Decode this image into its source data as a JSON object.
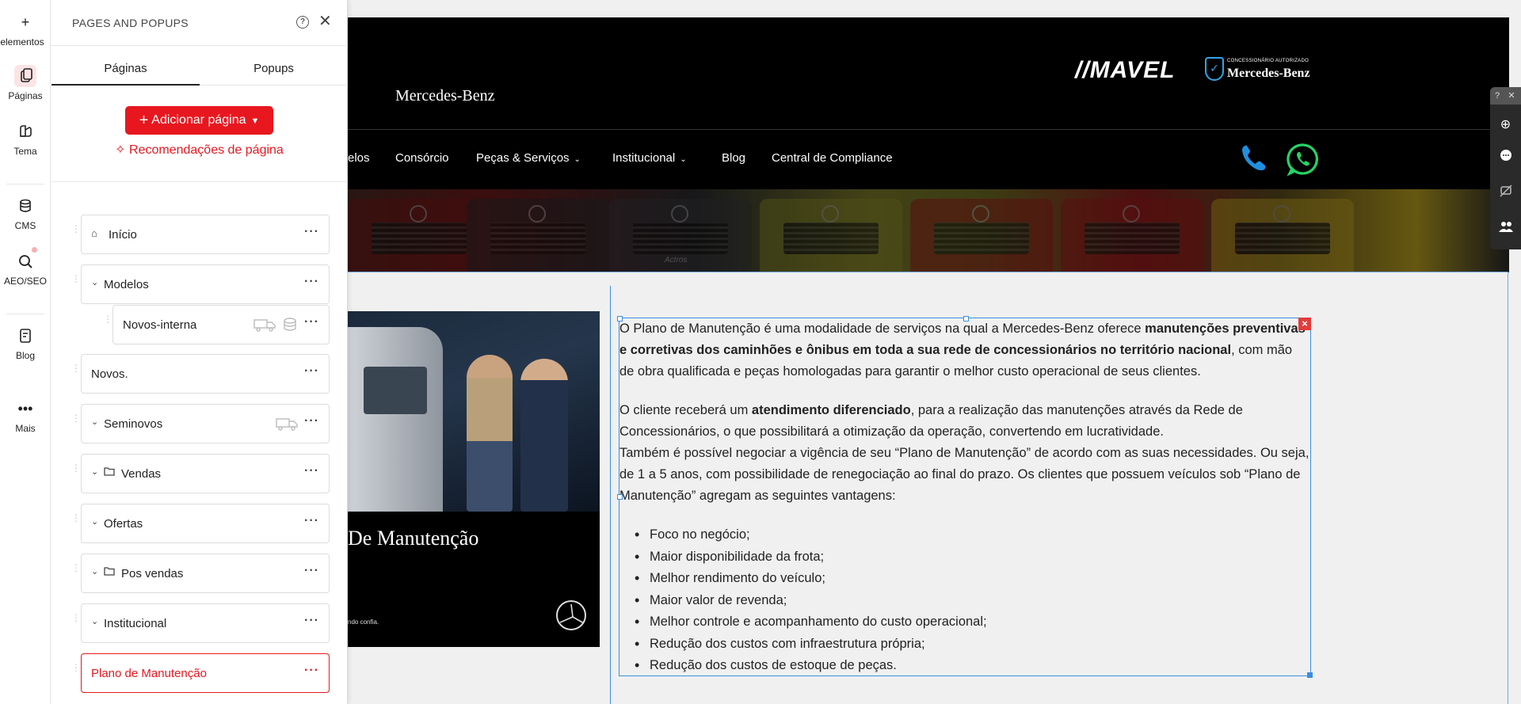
{
  "rail": {
    "items": [
      {
        "label": "elementos",
        "icon": "plus-icon"
      },
      {
        "label": "Páginas",
        "icon": "pages-icon",
        "active": true
      },
      {
        "label": "Tema",
        "icon": "palette-icon"
      },
      {
        "label": "CMS",
        "icon": "database-icon"
      },
      {
        "label": "AEO/SEO",
        "icon": "seo-search-icon"
      },
      {
        "label": "Blog",
        "icon": "blog-icon"
      },
      {
        "label": "Mais",
        "icon": "more-icon"
      }
    ]
  },
  "panel": {
    "title": "PAGES AND POPUPS",
    "tabs": [
      "Páginas",
      "Popups"
    ],
    "add_page_label": "Adicionar página",
    "recommend_label": "Recomendações de página",
    "pages": [
      {
        "label": "Início"
      },
      {
        "label": "Modelos"
      },
      {
        "label": "Novos-interna"
      },
      {
        "label": "Novos."
      },
      {
        "label": "Seminovos"
      },
      {
        "label": "Vendas"
      },
      {
        "label": "Ofertas"
      },
      {
        "label": "Pos vendas"
      },
      {
        "label": "Institucional"
      },
      {
        "label": "Plano de Manutenção"
      }
    ]
  },
  "site": {
    "brand_text": "Mercedes-Benz",
    "logo_text": "//MAVEL",
    "dealer_badge": "CONCESSIONÁRIO AUTORIZADO",
    "dealer_brand": "Mercedes-Benz",
    "nav": [
      "elos",
      "Consórcio",
      "Peças & Serviços",
      "Institucional",
      "Blog",
      "Central de Compliance"
    ],
    "banner_text": "Actros",
    "promo_caption": "De Manutenção",
    "promo_small": "ndo confia.",
    "paragraph1_a": "O Plano de Manutenção é uma modalidade de serviços na qual a Mercedes-Benz oferece ",
    "paragraph1_b": "manutenções preventivas e corretivas dos caminhões e ônibus em toda a sua rede de concessionários no território nacional",
    "paragraph1_c": ", com mão de obra qualificada e peças homologadas para garantir o melhor custo operacional de seus clientes.",
    "paragraph2_a": "O cliente receberá um ",
    "paragraph2_b": "atendimento diferenciado",
    "paragraph2_c": ", para a realização das manutenções através da Rede de Concessionários, o que possibilitará a otimização da operação, convertendo em lucratividade.",
    "paragraph3": "Também é possível negociar a vigência de seu “Plano de Manutenção” de acordo com as suas necessidades. Ou seja, de 1 a 5 anos, com possibilidade de renegociação ao final do prazo. Os clientes que possuem veículos sob “Plano de Manutenção” agregam as seguintes vantagens:",
    "benefits": [
      "Foco no negócio;",
      "Maior disponibilidade da frota;",
      "Melhor rendimento do veículo;",
      "Maior valor de revenda;",
      "Melhor controle e acompanhamento do custo operacional;",
      "Redução dos custos com infraestrutura própria;",
      "Redução dos custos de estoque de peças."
    ]
  },
  "colors": {
    "accent": "#e8171f",
    "selection": "#3b8ee0",
    "phone": "#1f8fe0",
    "whatsapp": "#25d366"
  }
}
